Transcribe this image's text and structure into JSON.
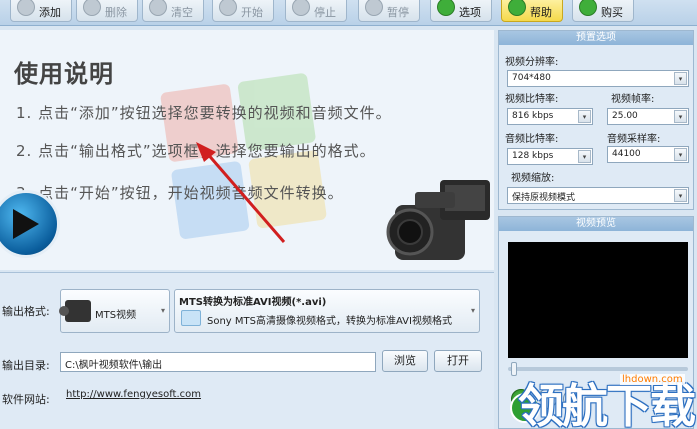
{
  "toolbar": {
    "buttons": [
      {
        "label": "添加",
        "state": "active"
      },
      {
        "label": "删除",
        "state": "disabled"
      },
      {
        "label": "清空",
        "state": "disabled"
      },
      {
        "label": "开始",
        "state": "disabled"
      },
      {
        "label": "停止",
        "state": "disabled"
      },
      {
        "label": "暂停",
        "state": "disabled"
      },
      {
        "label": "选项",
        "state": "active"
      },
      {
        "label": "帮助",
        "state": "highlight"
      },
      {
        "label": "购买",
        "state": "active"
      }
    ]
  },
  "help": {
    "title": "使用说明",
    "steps": [
      "1. 点击“添加”按钮选择您要转换的视频和音频文件。",
      "2. 点击“输出格式”选项框，选择您要输出的格式。",
      "3. 点击“开始”按钮，开始视频音频文件转换。"
    ]
  },
  "settings": {
    "output_format_label": "输出格式:",
    "format_name": "MTS视频",
    "format_title": "MTS转换为标准AVI视频(*.avi)",
    "format_desc": "Sony MTS高清摄像视频格式，转换为标准AVI视频格式",
    "output_dir_label": "输出目录:",
    "output_dir_value": "C:\\枫叶视频软件\\输出",
    "browse_label": "浏览",
    "open_label": "打开",
    "website_label": "软件网站:",
    "website_url": "http://www.fengyesoft.com"
  },
  "preset": {
    "title": "预置选项",
    "resolution_label": "视频分辨率:",
    "resolution_value": "704*480",
    "video_bitrate_label": "视频比特率:",
    "video_bitrate_value": "816 kbps",
    "framerate_label": "视频帧率:",
    "framerate_value": "25.00",
    "audio_bitrate_label": "音频比特率:",
    "audio_bitrate_value": "128 kbps",
    "samplerate_label": "音频采样率:",
    "samplerate_value": "44100",
    "scale_label": "视频缩放:",
    "scale_value": "保持原视频模式"
  },
  "preview": {
    "title": "视频预览"
  },
  "watermark": {
    "text": "领航下载",
    "url": "lhdown.com"
  },
  "colors": {
    "panel_header": "#8db4d8",
    "background": "#d9e6f2",
    "arrow": "#d11f1f"
  }
}
